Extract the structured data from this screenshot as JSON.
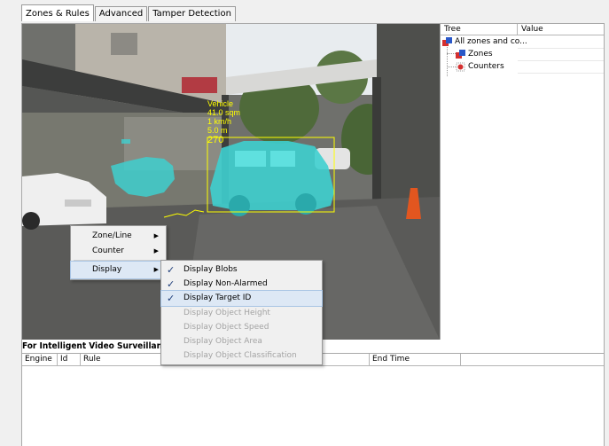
{
  "tabs": [
    {
      "label": "Zones & Rules",
      "active": true
    },
    {
      "label": "Advanced",
      "active": false
    },
    {
      "label": "Tamper Detection",
      "active": false
    }
  ],
  "overlay": {
    "lines": [
      "Vehicle",
      "41.0  sqm",
      "1  km/h",
      "5.0 m",
      "270"
    ],
    "color": "#ffff00"
  },
  "tree": {
    "col_tree": "Tree",
    "col_value": "Value",
    "items": [
      {
        "label": "All zones and co...",
        "icon": "zones-root-icon"
      },
      {
        "label": "Zones",
        "icon": "zone-icon"
      },
      {
        "label": "Counters",
        "icon": "counter-icon"
      }
    ]
  },
  "bottom": {
    "title": "For Intelligent Video Surveillance",
    "columns": [
      "Engine",
      "Id",
      "Rule",
      "End Time"
    ]
  },
  "context_menu": {
    "items": [
      {
        "label": "Zone/Line",
        "has_submenu": true
      },
      {
        "label": "Counter",
        "has_submenu": true
      },
      {
        "label": "Display",
        "has_submenu": true,
        "highlighted": true
      }
    ]
  },
  "display_submenu": {
    "items": [
      {
        "label": "Display Blobs",
        "checked": true,
        "enabled": true
      },
      {
        "label": "Display Non-Alarmed",
        "checked": true,
        "enabled": true
      },
      {
        "label": "Display Target ID",
        "checked": true,
        "enabled": true,
        "highlighted": true
      },
      {
        "label": "Display Object Height",
        "checked": false,
        "enabled": false
      },
      {
        "label": "Display Object Speed",
        "checked": false,
        "enabled": false
      },
      {
        "label": "Display Object Area",
        "checked": false,
        "enabled": false
      },
      {
        "label": "Display Object Classification",
        "checked": false,
        "enabled": false
      }
    ]
  },
  "symbols": {
    "check": "✓",
    "arrow": "▶"
  },
  "colors": {
    "blob": "#3ecfcf",
    "overlay": "#ffff00",
    "highlight": "#dde8f5"
  }
}
